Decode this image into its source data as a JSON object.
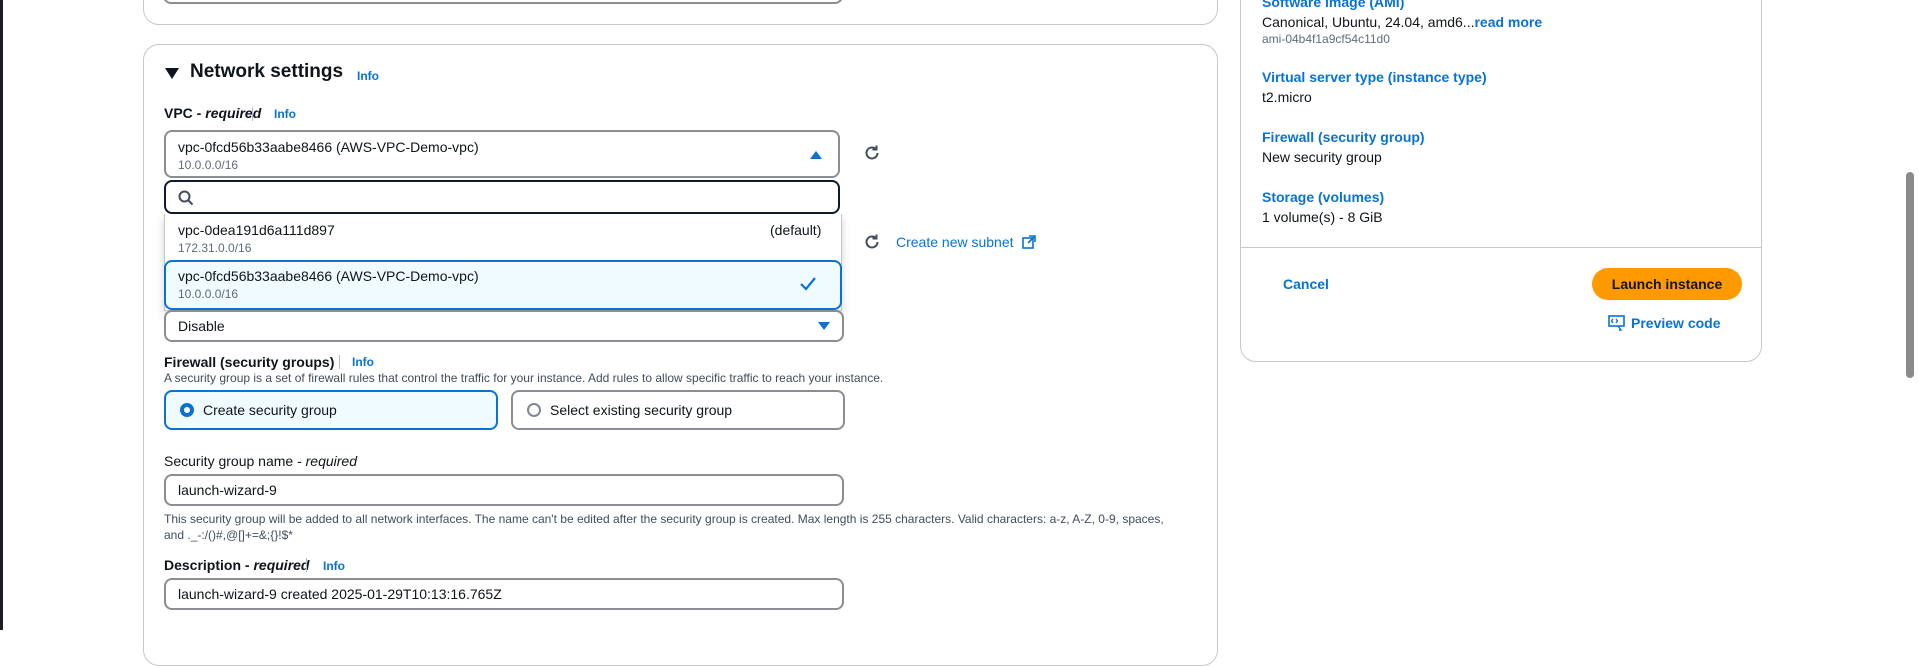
{
  "network": {
    "title": "Network settings",
    "info": "Info",
    "vpc": {
      "label": "VPC",
      "required": "required",
      "info": "Info",
      "selected_name": "vpc-0fcd56b33aabe8466 (AWS-VPC-Demo-vpc)",
      "selected_cidr": "10.0.0.0/16",
      "search_placeholder": "",
      "options": [
        {
          "name": "vpc-0dea191d6a111d897",
          "cidr": "172.31.0.0/16",
          "tag": "(default)"
        },
        {
          "name": "vpc-0fcd56b33aabe8466 (AWS-VPC-Demo-vpc)",
          "cidr": "10.0.0.0/16",
          "tag": ""
        }
      ]
    },
    "create_subnet": "Create new subnet",
    "public_ip": {
      "value": "Disable"
    },
    "firewall": {
      "label": "Firewall (security groups)",
      "info": "Info",
      "desc": "A security group is a set of firewall rules that control the traffic for your instance. Add rules to allow specific traffic to reach your instance.",
      "option_create": "Create security group",
      "option_existing": "Select existing security group"
    },
    "sg_name": {
      "label": "Security group name",
      "required": "required",
      "value": "launch-wizard-9",
      "help_line1": "This security group will be added to all network interfaces. The name can't be edited after the security group is created. Max length is 255 characters. Valid characters: a-z, A-Z, 0-9, spaces,",
      "help_line2": "and ._-:/()#,@[]+=&;{}!$*"
    },
    "description": {
      "label": "Description",
      "required": "required",
      "info": "Info",
      "value": "launch-wizard-9 created 2025-01-29T10:13:16.765Z"
    }
  },
  "summary": {
    "ami_label": "Software image (AMI)",
    "ami_value": "Canonical, Ubuntu, 24.04, amd6...",
    "ami_read_more": "read more",
    "ami_id": "ami-04b4f1a9cf54c11d0",
    "instance_type_label": "Virtual server type (instance type)",
    "instance_type_value": "t2.micro",
    "firewall_label": "Firewall (security group)",
    "firewall_value": "New security group",
    "storage_label": "Storage (volumes)",
    "storage_value": "1 volume(s) - 8 GiB",
    "cancel": "Cancel",
    "launch": "Launch instance",
    "preview": "Preview code"
  },
  "colors": {
    "accent": "#0972d3",
    "primary_button": "#ff9900"
  }
}
